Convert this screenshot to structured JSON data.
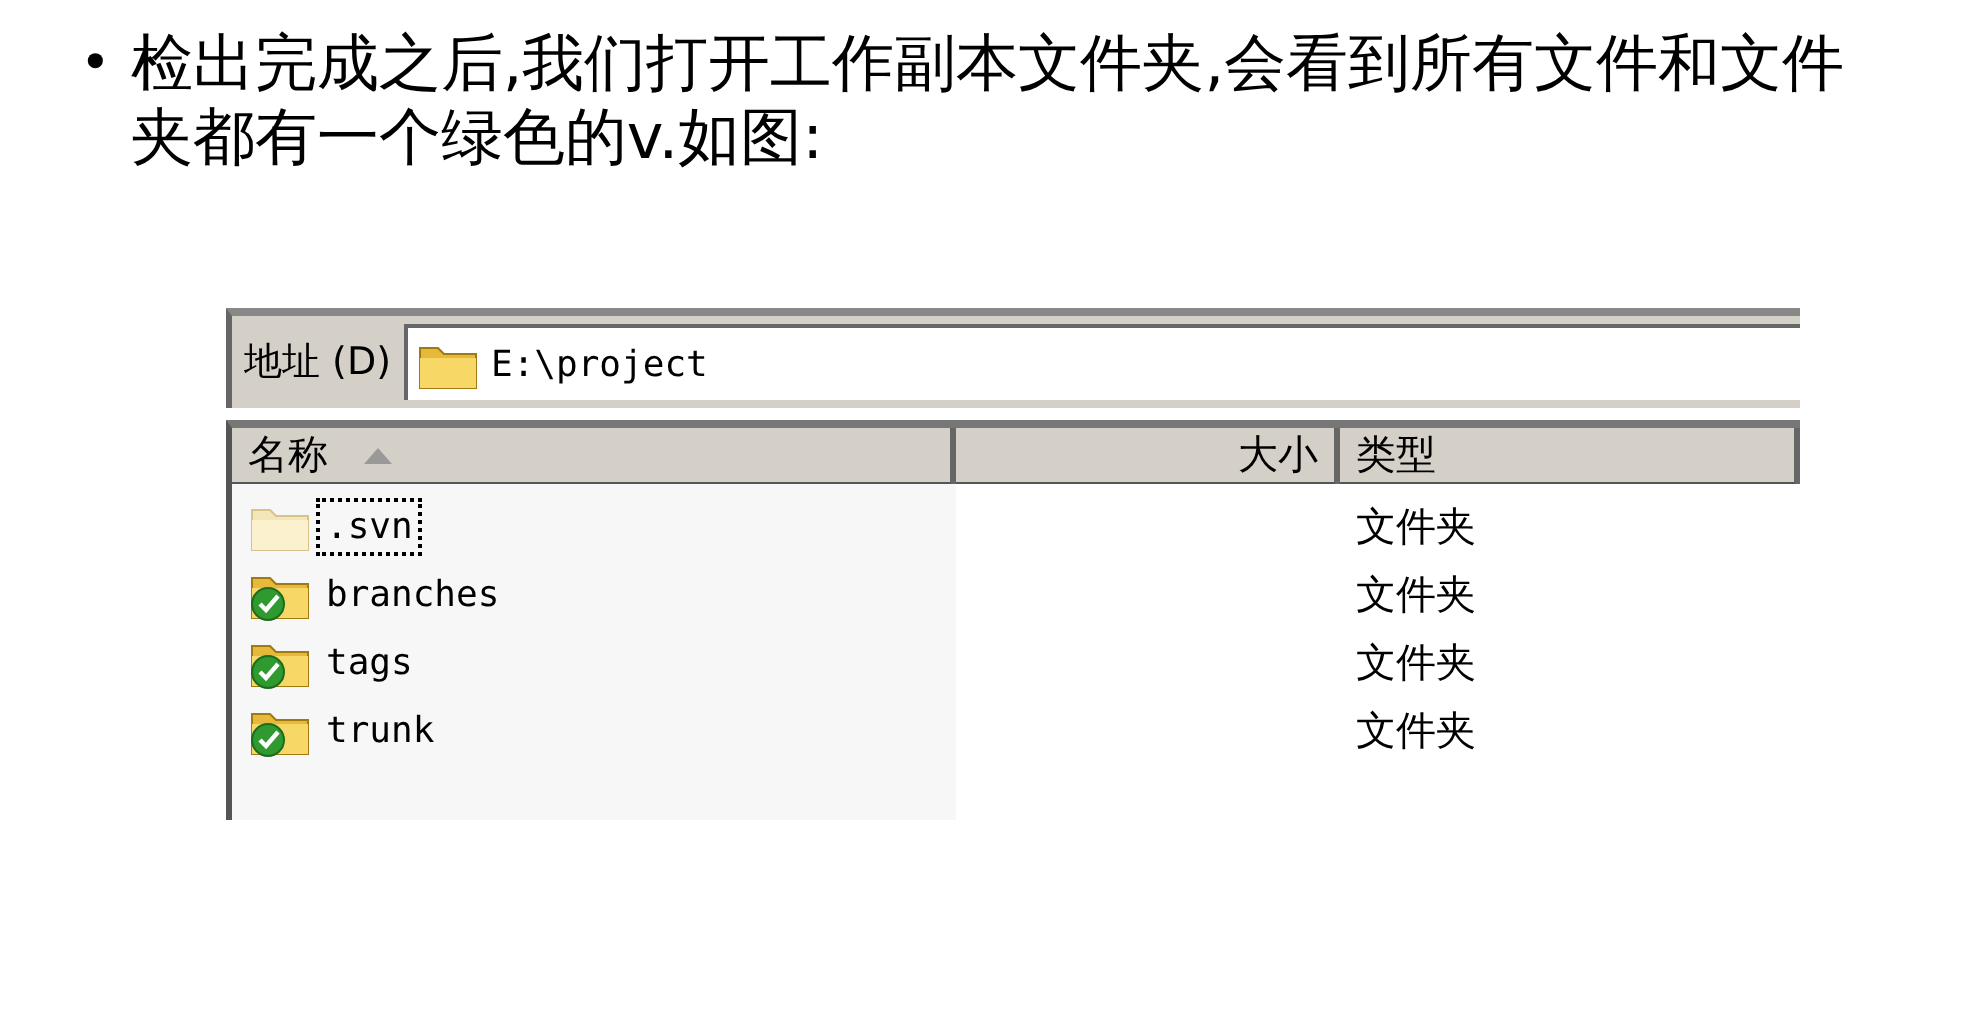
{
  "slide": {
    "bullet": "•",
    "text": "检出完成之后,我们打开工作副本文件夹,会看到所有文件和文件夹都有一个绿色的v.如图:"
  },
  "explorer": {
    "address_label": "地址 (D)",
    "address": "E:\\project",
    "columns": [
      {
        "label": "名称",
        "sorted": true
      },
      {
        "label": "大小",
        "sorted": false
      },
      {
        "label": "类型",
        "sorted": false
      }
    ],
    "rows": [
      {
        "name": ".svn",
        "type": "文件夹",
        "kind": "unversioned",
        "selected": true
      },
      {
        "name": "branches",
        "type": "文件夹",
        "kind": "versioned",
        "selected": false
      },
      {
        "name": "tags",
        "type": "文件夹",
        "kind": "versioned",
        "selected": false
      },
      {
        "name": "trunk",
        "type": "文件夹",
        "kind": "versioned",
        "selected": false
      }
    ]
  }
}
